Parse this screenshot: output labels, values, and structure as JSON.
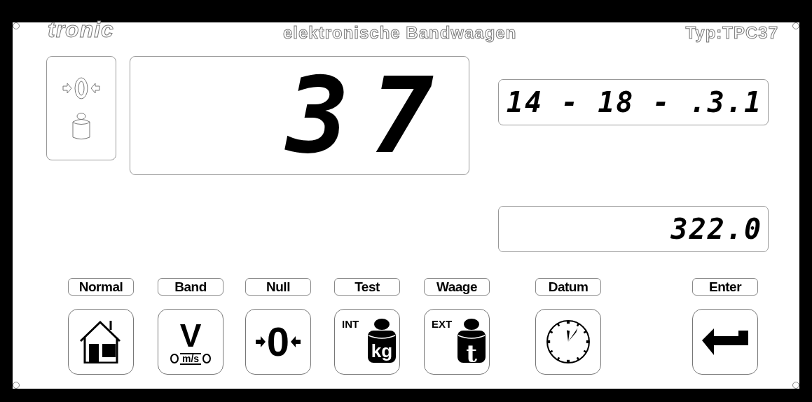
{
  "header": {
    "brand": "tronic",
    "title": "elektronische Bandwaagen",
    "model": "Typ:TPC37"
  },
  "main_display": {
    "value": "37"
  },
  "displays": [
    {
      "value": "14 - 18 - .3.1"
    },
    {
      "value": "322.0"
    }
  ],
  "keys": [
    {
      "label": "Normal",
      "kind": "home"
    },
    {
      "label": "Band",
      "kind": "speed",
      "symbol": "V",
      "unit": "m/s"
    },
    {
      "label": "Null",
      "kind": "zero",
      "symbol": "0"
    },
    {
      "label": "Test",
      "kind": "weight",
      "tag": "INT",
      "unit": "kg"
    },
    {
      "label": "Waage",
      "kind": "weight",
      "tag": "EXT",
      "unit": "t"
    },
    {
      "label": "Datum",
      "kind": "clock"
    },
    {
      "label": "Enter",
      "kind": "enter"
    }
  ]
}
